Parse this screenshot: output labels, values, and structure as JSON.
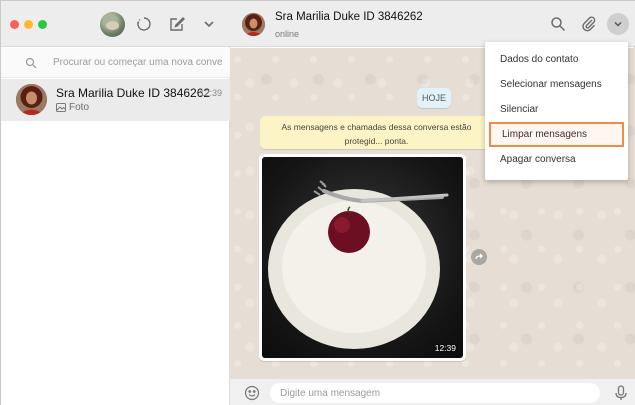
{
  "sidebar": {
    "search": {
      "placeholder": "Procurar ou começar uma nova conve..."
    },
    "chats": [
      {
        "name": "Sra Marilia Duke ID 3846262",
        "time": "12:39",
        "last_message": "Foto",
        "last_message_icon": "photo-icon"
      }
    ]
  },
  "conversation": {
    "contact_name": "Sra Marilia Duke ID 3846262",
    "status": "online",
    "date_chip": "HOJE",
    "notice": "As mensagens e chamadas dessa conversa estão protegid... ponta.",
    "photo_time": "12:39",
    "composer_placeholder": "Digite uma mensagem"
  },
  "context_menu": {
    "items": [
      {
        "label": "Dados do contato"
      },
      {
        "label": "Selecionar mensagens"
      },
      {
        "label": "Silenciar"
      },
      {
        "label": "Limpar mensagens",
        "highlighted": true
      },
      {
        "label": "Apagar conversa"
      }
    ],
    "highlight_color": "#f08b4a"
  },
  "colors": {
    "header_bg": "#ededed",
    "chat_bg": "#e6ded4",
    "notice_bg": "#fdf4c5",
    "date_chip_bg": "#e1f2fb"
  }
}
